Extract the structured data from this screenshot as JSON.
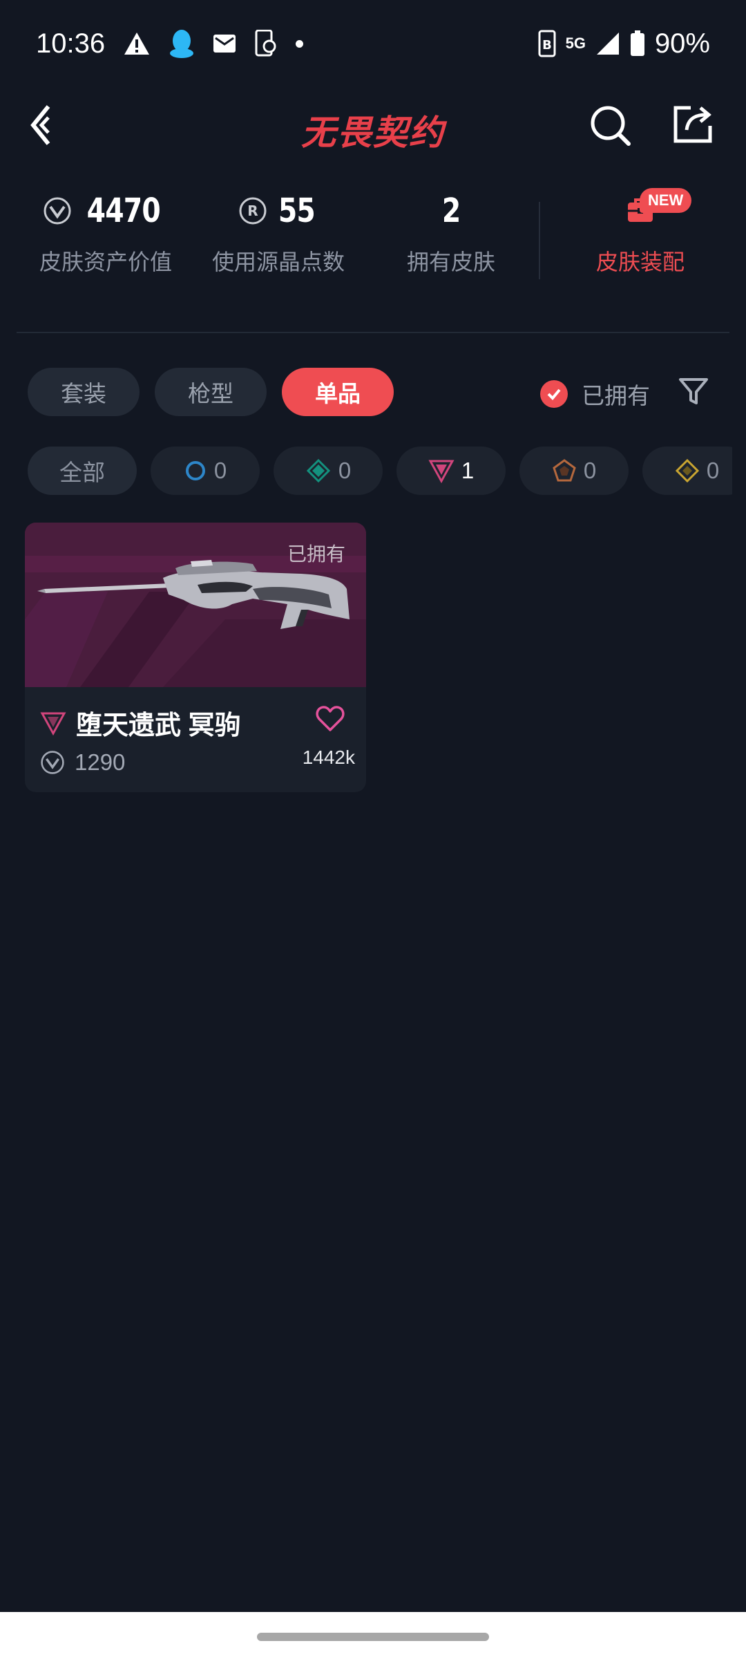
{
  "status_bar": {
    "time": "10:36",
    "network": "5G",
    "battery": "90%"
  },
  "header": {
    "title": "无畏契约"
  },
  "stats": {
    "asset_value": {
      "value": "4470",
      "label": "皮肤资产价值"
    },
    "radianite_points": {
      "value": "55",
      "label": "使用源晶点数"
    },
    "owned_skins": {
      "value": "2",
      "label": "拥有皮肤"
    },
    "loadout": {
      "label": "皮肤装配",
      "badge": "NEW"
    }
  },
  "tabs": [
    {
      "label": "套装",
      "active": false
    },
    {
      "label": "枪型",
      "active": false
    },
    {
      "label": "单品",
      "active": true
    }
  ],
  "owned_filter": {
    "label": "已拥有",
    "checked": true
  },
  "rarity_chips": [
    {
      "label": "全部"
    },
    {
      "icon": "select-tier-icon",
      "color": "#2d86c9",
      "count": "0"
    },
    {
      "icon": "deluxe-tier-icon",
      "color": "#14917e",
      "count": "0"
    },
    {
      "icon": "premium-tier-icon",
      "color": "#d1457c",
      "count": "1"
    },
    {
      "icon": "exclusive-tier-icon",
      "color": "#b5683d",
      "count": "0"
    },
    {
      "icon": "ultra-tier-icon",
      "color": "#c9a531",
      "count": "0"
    }
  ],
  "skins": [
    {
      "owned_tag": "已拥有",
      "name": "堕天遗武 冥驹",
      "tier_icon": "premium-tier-icon",
      "price": "1290",
      "likes": "1442k",
      "image": "operator-sniper-rifle"
    }
  ],
  "colors": {
    "background": "#121722",
    "accent": "#ef4d52",
    "card_banner": "#4a1d3d"
  }
}
